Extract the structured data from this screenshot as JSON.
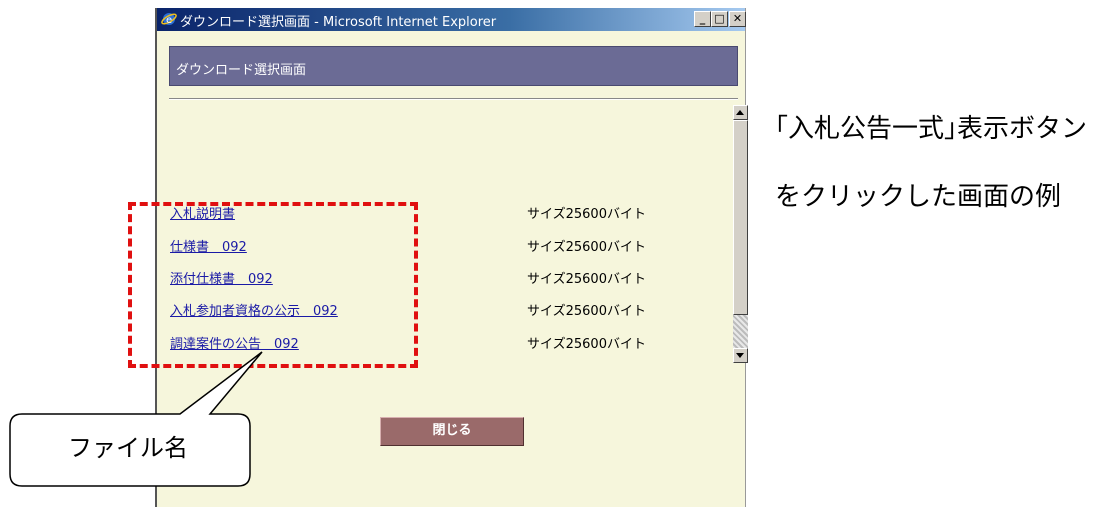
{
  "window": {
    "title": "ダウンロード選択画面 - Microsoft Internet Explorer",
    "minimize_glyph": "_",
    "maximize_glyph": "□",
    "close_glyph": "✕",
    "icon": "ie-icon"
  },
  "page": {
    "header_title": "ダウンロード選択画面",
    "files": [
      {
        "name": "入札説明書",
        "size": "サイズ25600バイト"
      },
      {
        "name": "仕様書　092",
        "size": "サイズ25600バイト"
      },
      {
        "name": "添付仕様書　092",
        "size": "サイズ25600バイト"
      },
      {
        "name": "入札参加者資格の公示　092",
        "size": "サイズ25600バイト"
      },
      {
        "name": "調達案件の公告　092",
        "size": "サイズ25600バイト"
      }
    ],
    "close_label": "閉じる"
  },
  "annotation": {
    "callout_label": "ファイル名",
    "caption_line1": "｢入札公告一式｣表示ボタン",
    "caption_line2": "をクリックした画面の例"
  },
  "colors": {
    "window_bg": "#f6f6dc",
    "header_bg": "#6b6b95",
    "link": "#1a1aa6",
    "dash": "#e01010",
    "close_btn": "#9a6a6a"
  }
}
